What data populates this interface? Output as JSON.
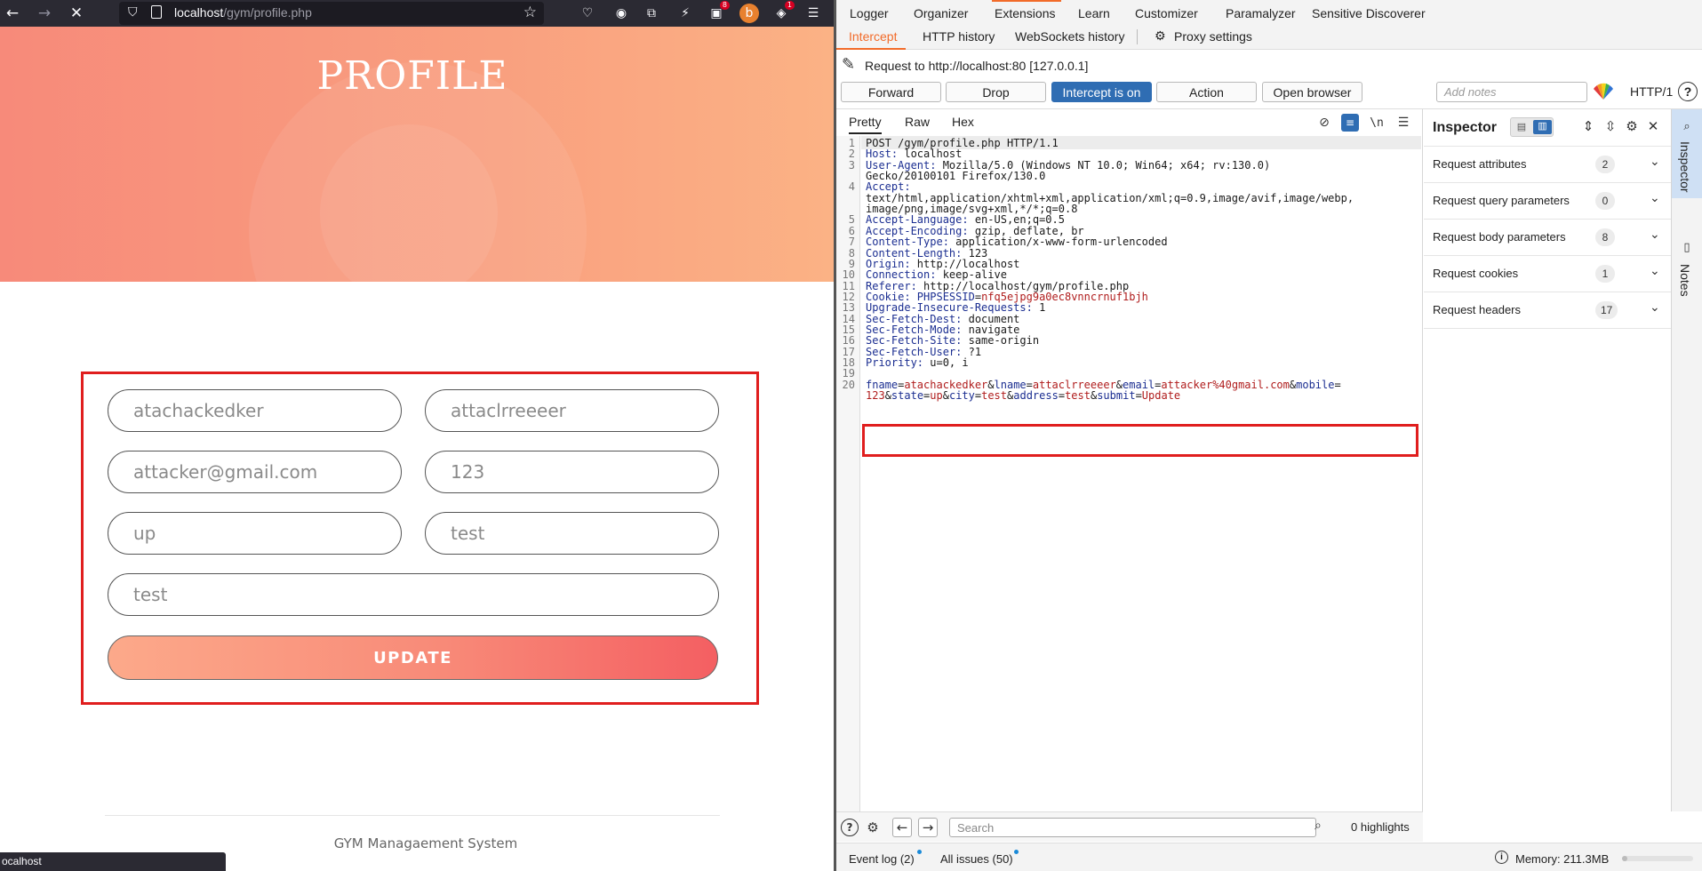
{
  "browser": {
    "url_host": "localhost",
    "url_path": "/gym/profile.php",
    "status_url": "ocalhost",
    "ext_badges": [
      "8",
      "1"
    ]
  },
  "page": {
    "title": "PROFILE",
    "fields": {
      "fname": "atachackedker",
      "lname": "attaclrreeeer",
      "email": "attacker@gmail.com",
      "mobile": "123",
      "state": "up",
      "city": "test",
      "address": "test"
    },
    "update_label": "UPDATE",
    "footer": "GYM Managaement System"
  },
  "burp": {
    "top_tabs": [
      "Logger",
      "Organizer",
      "Extensions",
      "Learn",
      "Customizer",
      "Paramalyzer",
      "Sensitive Discoverer"
    ],
    "sub_tabs": [
      "Intercept",
      "HTTP history",
      "WebSockets history",
      "Proxy settings"
    ],
    "request_to": "Request to http://localhost:80  [127.0.0.1]",
    "buttons": [
      "Forward",
      "Drop",
      "Intercept is on",
      "Action",
      "Open browser"
    ],
    "notes_placeholder": "Add notes",
    "http_version": "HTTP/1",
    "editor_tabs": [
      "Pretty",
      "Raw",
      "Hex"
    ],
    "request_lines": [
      {
        "n": "1",
        "parts": [
          {
            "t": "POST /gym/profile.php HTTP/1.1",
            "c": ""
          }
        ]
      },
      {
        "n": "2",
        "parts": [
          {
            "t": "Host:",
            "c": "hk"
          },
          {
            "t": " localhost",
            "c": ""
          }
        ]
      },
      {
        "n": "3",
        "parts": [
          {
            "t": "User-Agent:",
            "c": "hk"
          },
          {
            "t": " Mozilla/5.0 (Windows NT 10.0; Win64; x64; rv:130.0)",
            "c": ""
          }
        ]
      },
      {
        "n": "",
        "parts": [
          {
            "t": "Gecko/20100101 Firefox/130.0",
            "c": ""
          }
        ]
      },
      {
        "n": "4",
        "parts": [
          {
            "t": "Accept:",
            "c": "hk"
          }
        ]
      },
      {
        "n": "",
        "parts": [
          {
            "t": "text/html,application/xhtml+xml,application/xml;q=0.9,image/avif,image/webp,",
            "c": ""
          }
        ]
      },
      {
        "n": "",
        "parts": [
          {
            "t": "image/png,image/svg+xml,*/*;q=0.8",
            "c": ""
          }
        ]
      },
      {
        "n": "5",
        "parts": [
          {
            "t": "Accept-Language:",
            "c": "hk"
          },
          {
            "t": " en-US,en;q=0.5",
            "c": ""
          }
        ]
      },
      {
        "n": "6",
        "parts": [
          {
            "t": "Accept-Encoding:",
            "c": "hk"
          },
          {
            "t": " gzip, deflate, br",
            "c": ""
          }
        ]
      },
      {
        "n": "7",
        "parts": [
          {
            "t": "Content-Type:",
            "c": "hk"
          },
          {
            "t": " application/x-www-form-urlencoded",
            "c": ""
          }
        ]
      },
      {
        "n": "8",
        "parts": [
          {
            "t": "Content-Length:",
            "c": "hk"
          },
          {
            "t": " 123",
            "c": ""
          }
        ]
      },
      {
        "n": "9",
        "parts": [
          {
            "t": "Origin:",
            "c": "hk"
          },
          {
            "t": " http://localhost",
            "c": ""
          }
        ]
      },
      {
        "n": "10",
        "parts": [
          {
            "t": "Connection:",
            "c": "hk"
          },
          {
            "t": " keep-alive",
            "c": ""
          }
        ]
      },
      {
        "n": "11",
        "parts": [
          {
            "t": "Referer:",
            "c": "hk"
          },
          {
            "t": " http://localhost/gym/profile.php",
            "c": ""
          }
        ]
      },
      {
        "n": "12",
        "parts": [
          {
            "t": "Cookie:",
            "c": "hk"
          },
          {
            "t": " PHPSESSID",
            "c": "hk"
          },
          {
            "t": "=",
            "c": ""
          },
          {
            "t": "nfq5ejpg9a0ec8vnncrnuf1bjh",
            "c": "bv"
          }
        ]
      },
      {
        "n": "13",
        "parts": [
          {
            "t": "Upgrade-Insecure-Requests:",
            "c": "hk"
          },
          {
            "t": " 1",
            "c": ""
          }
        ]
      },
      {
        "n": "14",
        "parts": [
          {
            "t": "Sec-Fetch-Dest:",
            "c": "hk"
          },
          {
            "t": " document",
            "c": ""
          }
        ]
      },
      {
        "n": "15",
        "parts": [
          {
            "t": "Sec-Fetch-Mode:",
            "c": "hk"
          },
          {
            "t": " navigate",
            "c": ""
          }
        ]
      },
      {
        "n": "16",
        "parts": [
          {
            "t": "Sec-Fetch-Site:",
            "c": "hk"
          },
          {
            "t": " same-origin",
            "c": ""
          }
        ]
      },
      {
        "n": "17",
        "parts": [
          {
            "t": "Sec-Fetch-User:",
            "c": "hk"
          },
          {
            "t": " ?1",
            "c": ""
          }
        ]
      },
      {
        "n": "18",
        "parts": [
          {
            "t": "Priority:",
            "c": "hk"
          },
          {
            "t": " u=0, i",
            "c": ""
          }
        ]
      },
      {
        "n": "19",
        "parts": []
      },
      {
        "n": "20",
        "parts": [
          {
            "t": "fname",
            "c": "hk"
          },
          {
            "t": "=",
            "c": ""
          },
          {
            "t": "atachackedker",
            "c": "bv"
          },
          {
            "t": "&",
            "c": ""
          },
          {
            "t": "lname",
            "c": "hk"
          },
          {
            "t": "=",
            "c": ""
          },
          {
            "t": "attaclrreeeer",
            "c": "bv"
          },
          {
            "t": "&",
            "c": ""
          },
          {
            "t": "email",
            "c": "hk"
          },
          {
            "t": "=",
            "c": ""
          },
          {
            "t": "attacker%40gmail.com",
            "c": "bv"
          },
          {
            "t": "&",
            "c": ""
          },
          {
            "t": "mobile",
            "c": "hk"
          },
          {
            "t": "=",
            "c": ""
          }
        ]
      },
      {
        "n": "",
        "parts": [
          {
            "t": "123",
            "c": "bv"
          },
          {
            "t": "&",
            "c": ""
          },
          {
            "t": "state",
            "c": "hk"
          },
          {
            "t": "=",
            "c": ""
          },
          {
            "t": "up",
            "c": "bv"
          },
          {
            "t": "&",
            "c": ""
          },
          {
            "t": "city",
            "c": "hk"
          },
          {
            "t": "=",
            "c": ""
          },
          {
            "t": "test",
            "c": "bv"
          },
          {
            "t": "&",
            "c": ""
          },
          {
            "t": "address",
            "c": "hk"
          },
          {
            "t": "=",
            "c": ""
          },
          {
            "t": "test",
            "c": "bv"
          },
          {
            "t": "&",
            "c": ""
          },
          {
            "t": "submit",
            "c": "hk"
          },
          {
            "t": "=",
            "c": ""
          },
          {
            "t": "Update",
            "c": "bv"
          }
        ]
      }
    ],
    "inspector": {
      "title": "Inspector",
      "rows": [
        {
          "label": "Request attributes",
          "count": "2"
        },
        {
          "label": "Request query parameters",
          "count": "0"
        },
        {
          "label": "Request body parameters",
          "count": "8"
        },
        {
          "label": "Request cookies",
          "count": "1"
        },
        {
          "label": "Request headers",
          "count": "17"
        }
      ]
    },
    "side_tabs": [
      "Inspector",
      "Notes"
    ],
    "search_placeholder": "Search",
    "highlights": "0 highlights",
    "event_log": "Event log (2)",
    "all_issues": "All issues (50)",
    "memory": "Memory: 211.3MB",
    "colors": {
      "accent": "#f26b29",
      "intercept_on": "#2f6db3",
      "highlight_box": "#e01e1e"
    }
  }
}
